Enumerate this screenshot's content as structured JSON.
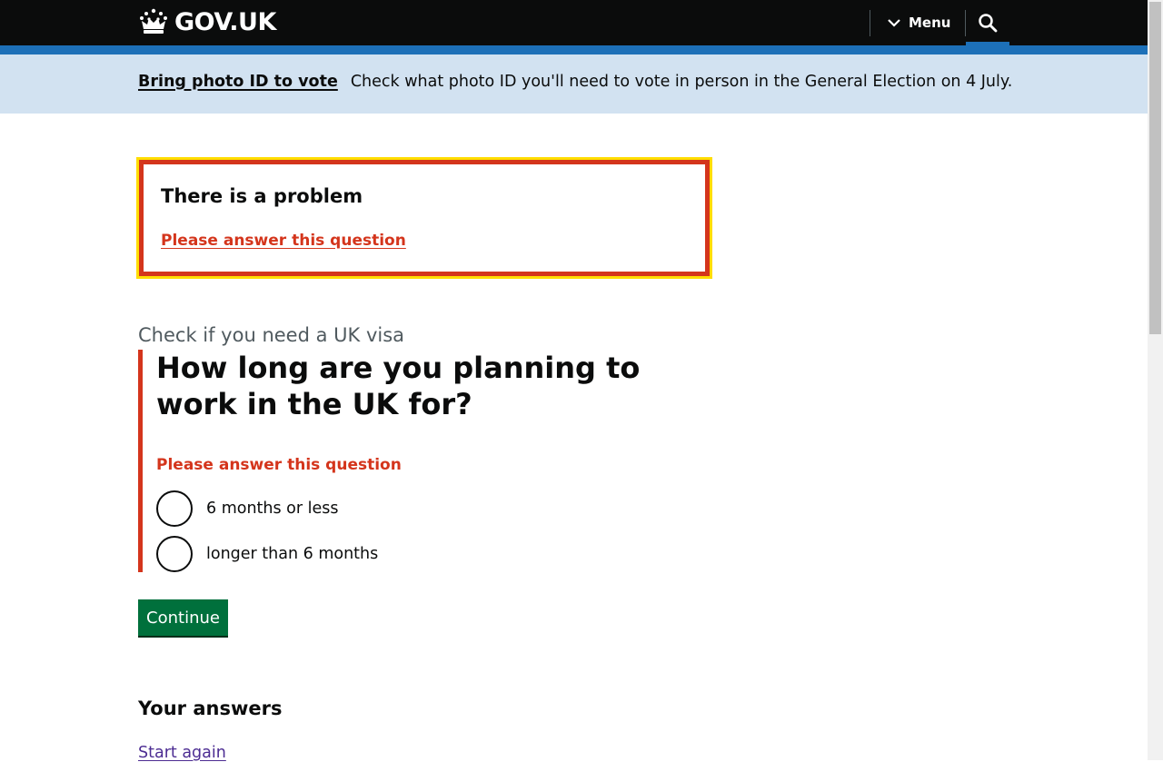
{
  "header": {
    "logo_text": "GOV.UK",
    "menu_label": "Menu",
    "colors": {
      "header_bg": "#0b0c0c",
      "blue_bar": "#1d70b8"
    },
    "icons": [
      "crown-icon",
      "chevron-down-icon",
      "search-icon"
    ]
  },
  "banner": {
    "link_text": "Bring photo ID to vote",
    "message": "Check what photo ID you'll need to vote in person in the General Election on 4 July."
  },
  "error_summary": {
    "title": "There is a problem",
    "link_text": "Please answer this question"
  },
  "question": {
    "caption": "Check if you need a UK visa",
    "heading": "How long are you planning to work in the UK for?",
    "error_message": "Please answer this question",
    "options": [
      {
        "label": "6 months or less",
        "selected": false
      },
      {
        "label": "longer than 6 months",
        "selected": false
      }
    ]
  },
  "actions": {
    "continue_label": "Continue"
  },
  "answers": {
    "title": "Your answers",
    "start_again_label": "Start again"
  },
  "colors": {
    "error": "#d4351c",
    "focus": "#ffdd00",
    "button": "#00703c",
    "visited_link": "#4c2c92",
    "banner_bg": "#d2e2f1"
  }
}
